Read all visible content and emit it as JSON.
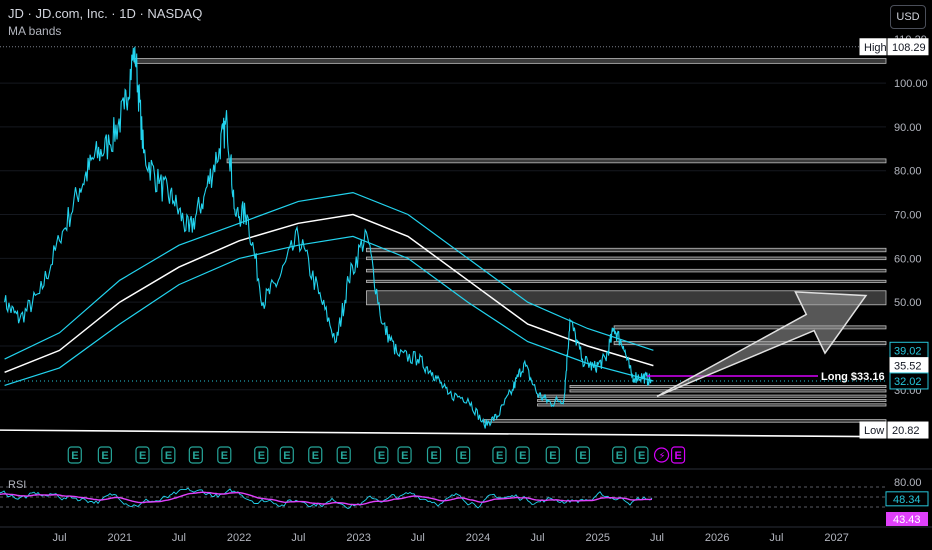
{
  "header": {
    "symbol_line": "JD · JD.com, Inc. · 1D · NASDAQ",
    "indicator": "MA bands",
    "currency_button": "USD"
  },
  "price_labels": {
    "high_tag": "High",
    "high_value": "108.29",
    "low_tag": "Low",
    "low_value": "20.82",
    "long_label": "Long $33.16",
    "band_upper": "39.02",
    "band_mid": "35.52",
    "current": "32.02",
    "rsi_label": "RSI",
    "rsi_value": "48.34",
    "rsi_ma_value": "43.43"
  },
  "colors": {
    "price_line": "#22d3ee",
    "ma_mid": "#ffffff",
    "rsi_line": "#e040fb",
    "long_line": "#d500f9",
    "earnings_badge": "#26a69a",
    "arrow_fill": "#9e9e9e",
    "zone_fill": "#3a3a3a"
  },
  "chart_data": {
    "type": "line",
    "title": "JD · JD.com, Inc. · 1D · NASDAQ",
    "indicator": "MA bands",
    "y_axis": {
      "ticks": [
        100,
        90,
        80,
        70,
        60,
        50,
        40,
        30
      ],
      "labels": [
        "100.00",
        "90.00",
        "80.00",
        "70.00",
        "60.00",
        "50.00",
        "40.00",
        "30.00"
      ],
      "ylim": [
        19,
        110.29
      ],
      "top_label": "110.29"
    },
    "x_axis": {
      "labels": [
        "Jul",
        "2021",
        "Jul",
        "2022",
        "Jul",
        "2023",
        "Jul",
        "2024",
        "Jul",
        "2025",
        "Jul",
        "2026",
        "Jul",
        "2027"
      ],
      "dates": [
        "2020-07",
        "2021-01",
        "2021-07",
        "2022-01",
        "2022-07",
        "2023-01",
        "2023-07",
        "2024-01",
        "2024-07",
        "2025-01",
        "2025-07",
        "2026-01",
        "2026-07",
        "2027-01"
      ],
      "xlim": [
        "2020-01-01",
        "2027-06-01"
      ]
    },
    "price_series": [
      [
        "2020-01-15",
        50
      ],
      [
        "2020-03-01",
        46
      ],
      [
        "2020-05-01",
        52
      ],
      [
        "2020-07-01",
        64
      ],
      [
        "2020-09-01",
        76
      ],
      [
        "2020-10-15",
        83
      ],
      [
        "2020-12-01",
        86
      ],
      [
        "2021-01-15",
        94
      ],
      [
        "2021-02-16",
        108.29
      ],
      [
        "2021-03-15",
        84
      ],
      [
        "2021-05-01",
        77
      ],
      [
        "2021-06-15",
        73
      ],
      [
        "2021-08-01",
        66
      ],
      [
        "2021-09-15",
        74
      ],
      [
        "2021-11-01",
        85
      ],
      [
        "2021-11-25",
        91
      ],
      [
        "2021-12-20",
        70
      ],
      [
        "2022-01-25",
        70
      ],
      [
        "2022-03-15",
        50
      ],
      [
        "2022-05-01",
        55
      ],
      [
        "2022-07-01",
        65
      ],
      [
        "2022-09-01",
        52
      ],
      [
        "2022-10-25",
        41
      ],
      [
        "2022-12-01",
        55
      ],
      [
        "2023-01-25",
        66
      ],
      [
        "2023-03-15",
        45
      ],
      [
        "2023-05-01",
        38
      ],
      [
        "2023-07-01",
        37
      ],
      [
        "2023-08-15",
        34
      ],
      [
        "2023-10-01",
        29
      ],
      [
        "2023-12-01",
        28
      ],
      [
        "2024-01-20",
        22
      ],
      [
        "2024-03-01",
        24
      ],
      [
        "2024-04-15",
        30
      ],
      [
        "2024-05-20",
        36
      ],
      [
        "2024-07-01",
        29
      ],
      [
        "2024-08-10",
        27
      ],
      [
        "2024-09-20",
        28
      ],
      [
        "2024-10-08",
        46
      ],
      [
        "2024-11-15",
        37
      ],
      [
        "2024-12-20",
        35
      ],
      [
        "2025-01-25",
        37
      ],
      [
        "2025-02-20",
        44
      ],
      [
        "2025-03-20",
        40
      ],
      [
        "2025-04-15",
        33
      ],
      [
        "2025-05-20",
        33
      ],
      [
        "2025-06-15",
        32.02
      ]
    ],
    "ma_mid": [
      [
        "2020-01-15",
        34
      ],
      [
        "2020-07-01",
        39
      ],
      [
        "2021-01-01",
        50
      ],
      [
        "2021-07-01",
        58
      ],
      [
        "2022-01-01",
        64
      ],
      [
        "2022-07-01",
        68
      ],
      [
        "2022-12-15",
        70
      ],
      [
        "2023-06-01",
        65
      ],
      [
        "2023-12-01",
        55
      ],
      [
        "2024-06-01",
        45
      ],
      [
        "2024-12-01",
        40
      ],
      [
        "2025-06-20",
        35.52
      ]
    ],
    "ma_upper": [
      [
        "2020-01-15",
        37
      ],
      [
        "2020-07-01",
        43
      ],
      [
        "2021-01-01",
        55
      ],
      [
        "2021-07-01",
        63
      ],
      [
        "2022-01-01",
        68
      ],
      [
        "2022-07-01",
        73
      ],
      [
        "2022-12-15",
        75
      ],
      [
        "2023-06-01",
        70
      ],
      [
        "2023-12-01",
        60
      ],
      [
        "2024-06-01",
        50
      ],
      [
        "2024-12-01",
        44
      ],
      [
        "2025-06-20",
        39.02
      ]
    ],
    "ma_lower": [
      [
        "2020-01-15",
        31
      ],
      [
        "2020-07-01",
        35
      ],
      [
        "2021-01-01",
        45
      ],
      [
        "2021-07-01",
        54
      ],
      [
        "2022-01-01",
        60
      ],
      [
        "2022-07-01",
        63
      ],
      [
        "2022-12-15",
        65
      ],
      [
        "2023-06-01",
        60
      ],
      [
        "2023-12-01",
        50
      ],
      [
        "2024-06-01",
        41
      ],
      [
        "2024-12-01",
        36
      ],
      [
        "2025-06-20",
        32
      ]
    ],
    "zones": [
      {
        "start": "2021-02-16",
        "end": "2027-06-01",
        "low": 104.5,
        "high": 105.6
      },
      {
        "start": "2021-11-25",
        "end": "2027-06-01",
        "low": 81.8,
        "high": 82.7
      },
      {
        "start": "2023-01-25",
        "end": "2027-06-01",
        "low": 61.5,
        "high": 62.3
      },
      {
        "start": "2023-01-25",
        "end": "2027-06-01",
        "low": 59.7,
        "high": 60.3
      },
      {
        "start": "2023-01-25",
        "end": "2027-06-01",
        "low": 56.9,
        "high": 57.5
      },
      {
        "start": "2023-01-25",
        "end": "2027-06-01",
        "low": 54.5,
        "high": 55
      },
      {
        "start": "2023-01-25",
        "end": "2027-06-01",
        "low": 49.4,
        "high": 52.6
      },
      {
        "start": "2025-02-20",
        "end": "2027-06-01",
        "low": 43.9,
        "high": 44.6
      },
      {
        "start": "2025-02-20",
        "end": "2027-06-01",
        "low": 40.3,
        "high": 41
      },
      {
        "start": "2024-10-08",
        "end": "2027-06-01",
        "low": 30.5,
        "high": 31
      },
      {
        "start": "2024-10-08",
        "end": "2027-06-01",
        "low": 29.5,
        "high": 30
      },
      {
        "start": "2024-07-01",
        "end": "2027-06-01",
        "low": 28.3,
        "high": 28.8
      },
      {
        "start": "2024-07-01",
        "end": "2027-06-01",
        "low": 27.3,
        "high": 27.8
      },
      {
        "start": "2024-07-01",
        "end": "2027-06-01",
        "low": 26.3,
        "high": 26.8
      },
      {
        "start": "2024-01-20",
        "end": "2027-06-01",
        "low": 22.6,
        "high": 23.2
      }
    ],
    "long_entry": 33.16,
    "high": 108.29,
    "low": 20.82,
    "support_line": [
      [
        "2020-01-01",
        20.8
      ],
      [
        "2027-06-01",
        19.3
      ]
    ],
    "target_arrow": {
      "tail": [
        "2025-07-01",
        28.5
      ],
      "head": [
        "2027-04-01",
        51.5
      ]
    },
    "earnings_dates": [
      "2020-08-15",
      "2020-11-15",
      "2021-03-10",
      "2021-05-28",
      "2021-08-20",
      "2021-11-15",
      "2022-03-08",
      "2022-05-25",
      "2022-08-20",
      "2022-11-15",
      "2023-03-10",
      "2023-05-20",
      "2023-08-18",
      "2023-11-15",
      "2024-03-05",
      "2024-05-15",
      "2024-08-15",
      "2024-11-15",
      "2025-03-06",
      "2025-05-13"
    ],
    "rsi": {
      "levels": [
        70,
        50,
        30
      ],
      "level_label": "80.00",
      "last": 48.34,
      "ma_last": 43.43
    }
  }
}
